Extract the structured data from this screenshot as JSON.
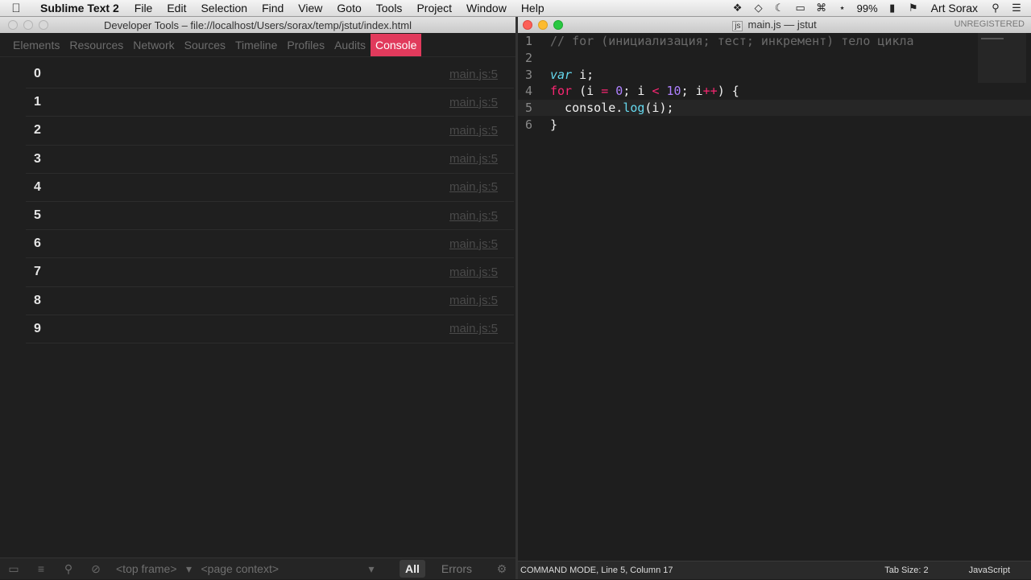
{
  "menubar": {
    "app_name": "Sublime Text 2",
    "items": [
      "File",
      "Edit",
      "Selection",
      "Find",
      "View",
      "Goto",
      "Tools",
      "Project",
      "Window",
      "Help"
    ],
    "battery": "99%",
    "user": "Art Sorax"
  },
  "devtools": {
    "title": "Developer Tools – file://localhost/Users/sorax/temp/jstut/index.html",
    "tabs": [
      "Elements",
      "Resources",
      "Network",
      "Sources",
      "Timeline",
      "Profiles",
      "Audits",
      "Console"
    ],
    "active_tab": "Console",
    "console_rows": [
      {
        "value": "0",
        "source": "main.js:5"
      },
      {
        "value": "1",
        "source": "main.js:5"
      },
      {
        "value": "2",
        "source": "main.js:5"
      },
      {
        "value": "3",
        "source": "main.js:5"
      },
      {
        "value": "4",
        "source": "main.js:5"
      },
      {
        "value": "5",
        "source": "main.js:5"
      },
      {
        "value": "6",
        "source": "main.js:5"
      },
      {
        "value": "7",
        "source": "main.js:5"
      },
      {
        "value": "8",
        "source": "main.js:5"
      },
      {
        "value": "9",
        "source": "main.js:5"
      }
    ],
    "status": {
      "frame_select": "<top frame>",
      "context_select": "<page context>",
      "filter_all": "All",
      "filter_errors": "Errors"
    }
  },
  "sublime": {
    "title": "main.js — jstut",
    "file_icon": "js",
    "unregistered": "UNREGISTERED",
    "status_mode": "COMMAND MODE, Line 5, Column 17",
    "tab_size": "Tab Size: 2",
    "syntax": "JavaScript",
    "line_numbers": [
      "1",
      "2",
      "3",
      "4",
      "5",
      "6"
    ],
    "code": {
      "line1": "// for (инициализация; тест; инкремент) тело цикла",
      "line3_kw": "var",
      "line3_rest": " i;",
      "line4_for": "for",
      "line4_a": " (i ",
      "line4_eq": "=",
      "line4_b": " ",
      "line4_zero": "0",
      "line4_c": "; i ",
      "line4_lt": "<",
      "line4_d": " ",
      "line4_ten": "10",
      "line4_e": "; i",
      "line4_inc": "++",
      "line4_f": ") {",
      "line5_a": "  console.",
      "line5_fn": "log",
      "line5_b": "(i);",
      "line6": "}"
    }
  }
}
